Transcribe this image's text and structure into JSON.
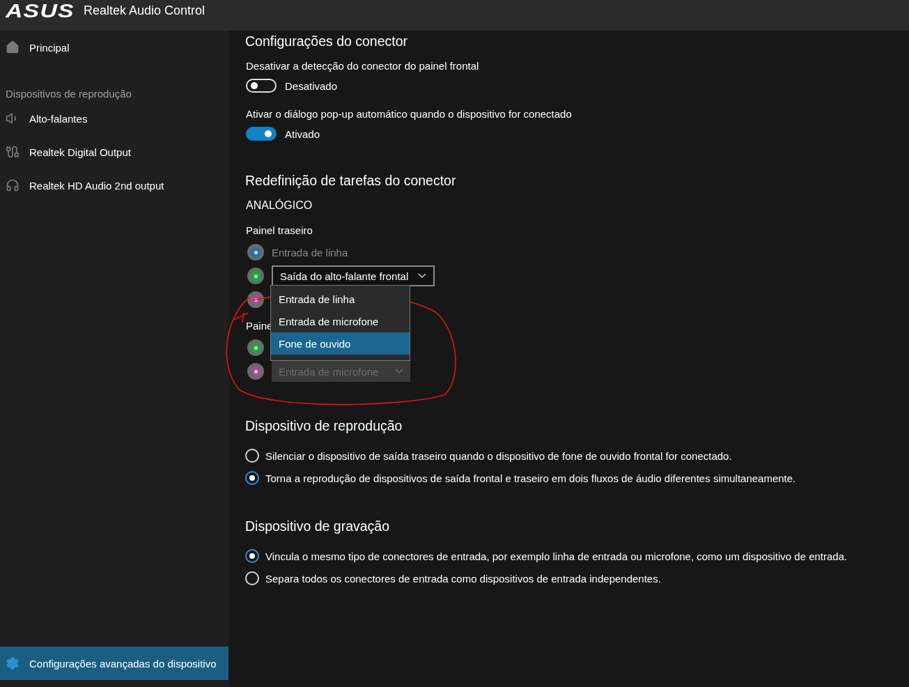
{
  "titlebar": {
    "logo": "ASUS",
    "title": "Realtek Audio Control"
  },
  "sidebar": {
    "items": [
      {
        "kind": "home",
        "label": "Principal",
        "selected": false
      }
    ],
    "section_label": "Dispositivos de reprodução",
    "devices": [
      {
        "kind": "speaker",
        "label": "Alto-falantes",
        "selected": false
      },
      {
        "kind": "digital",
        "label": "Realtek Digital Output",
        "selected": false
      },
      {
        "kind": "headphones",
        "label": "Realtek HD Audio 2nd output",
        "selected": false
      }
    ],
    "footer_item": {
      "kind": "settings",
      "label": "Configurações avançadas do dispositivo",
      "selected": true
    }
  },
  "connector_settings": {
    "title": "Configurações do conector",
    "toggles": [
      {
        "label": "Desativar a detecção do conector do painel frontal",
        "state_text": "Desativado",
        "on": false
      },
      {
        "label": "Ativar o diálogo pop-up automático quando o dispositivo for conectado",
        "state_text": "Ativado",
        "on": true
      }
    ]
  },
  "retasking": {
    "title": "Redefinição de tarefas do conector",
    "group_label": "ANALÓGICO",
    "panels": [
      {
        "label": "Painel traseiro",
        "jacks": [
          {
            "color": "#2a6fb0",
            "kind": "label",
            "text": "Entrada de linha"
          },
          {
            "color": "#1fa83a",
            "kind": "dropdown",
            "value": "Saída do alto-falante frontal",
            "disabled": false,
            "expanded": true,
            "options": [
              {
                "label": "Entrada de linha",
                "selected": false
              },
              {
                "label": "Entrada de microfone",
                "selected": false
              },
              {
                "label": "Fone de ouvido",
                "selected": true
              }
            ]
          },
          {
            "color": "#a04f8e",
            "kind": "covered"
          }
        ]
      },
      {
        "label": "Paine",
        "jacks": [
          {
            "color": "#1fa83a",
            "kind": "covered"
          },
          {
            "color": "#a04f8e",
            "kind": "dropdown",
            "value": "Entrada de microfone",
            "disabled": true,
            "expanded": false
          }
        ]
      }
    ]
  },
  "playback": {
    "title": "Dispositivo de reprodução",
    "options": [
      {
        "label": "Silenciar o dispositivo de saída traseiro quando o dispositivo de fone de ouvido frontal for conectado.",
        "selected": false
      },
      {
        "label": "Torna a reprodução de dispositivos de saída frontal e traseiro em dois fluxos de áudio diferentes simultaneamente.",
        "selected": true
      }
    ]
  },
  "recording": {
    "title": "Dispositivo de gravação",
    "options": [
      {
        "label": "Vincula o mesmo tipo de conectores de entrada, por exemplo linha de entrada ou microfone, como um dispositivo de entrada.",
        "selected": true
      },
      {
        "label": "Separa todos os conectores de entrada como dispositivos de entrada independentes.",
        "selected": false
      }
    ]
  }
}
